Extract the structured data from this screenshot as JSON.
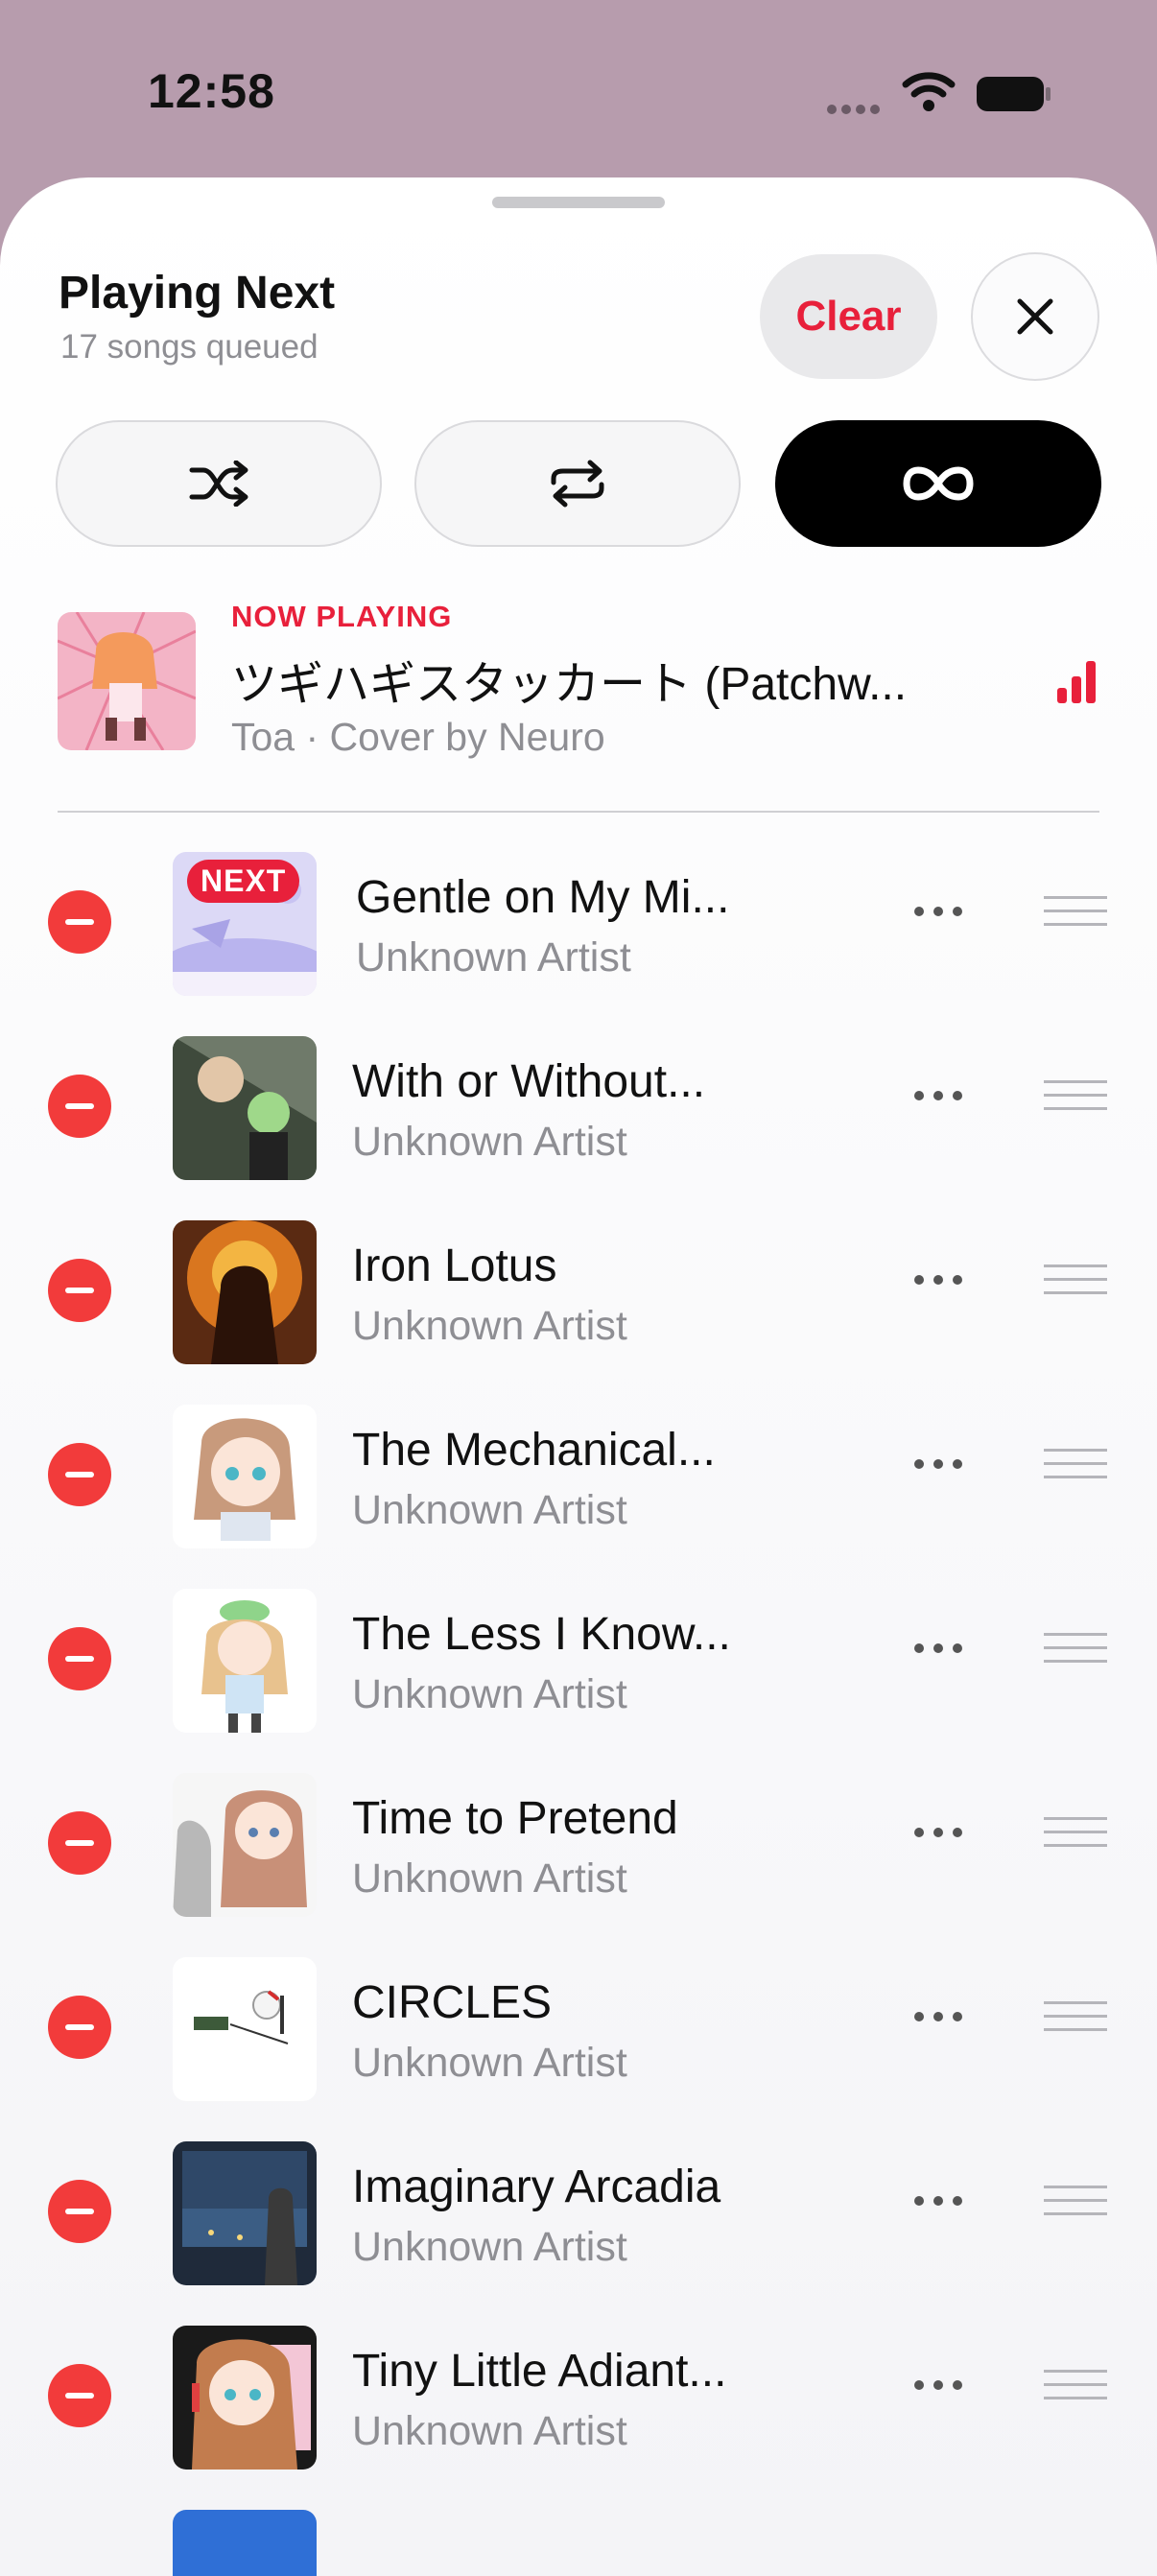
{
  "status_bar": {
    "time": "12:58"
  },
  "header": {
    "title": "Playing Next",
    "subtitle": "17 songs queued",
    "clear_label": "Clear"
  },
  "modes": [
    {
      "icon": "shuffle-icon",
      "active": false
    },
    {
      "icon": "repeat-icon",
      "active": false
    },
    {
      "icon": "infinity-icon",
      "active": true
    }
  ],
  "now_playing": {
    "label": "NOW PLAYING",
    "title": "ツギハギスタッカート (Patchw...",
    "artist": "Toa · Cover by Neuro"
  },
  "next_badge": "NEXT",
  "queue": [
    {
      "title": "Gentle on My Mi...",
      "artist": "Unknown Artist"
    },
    {
      "title": "With or Without...",
      "artist": "Unknown Artist"
    },
    {
      "title": "Iron Lotus",
      "artist": "Unknown Artist"
    },
    {
      "title": "The Mechanical...",
      "artist": "Unknown Artist"
    },
    {
      "title": "The Less I Know...",
      "artist": "Unknown Artist"
    },
    {
      "title": "Time to Pretend",
      "artist": "Unknown Artist"
    },
    {
      "title": "CIRCLES",
      "artist": "Unknown Artist"
    },
    {
      "title": "Imaginary Arcadia",
      "artist": "Unknown Artist"
    },
    {
      "title": "Tiny Little Adiant...",
      "artist": "Unknown Artist"
    }
  ],
  "colors": {
    "accent": "#e8203b",
    "remove": "#f23b3b",
    "secondary_text": "#8e8e93"
  }
}
